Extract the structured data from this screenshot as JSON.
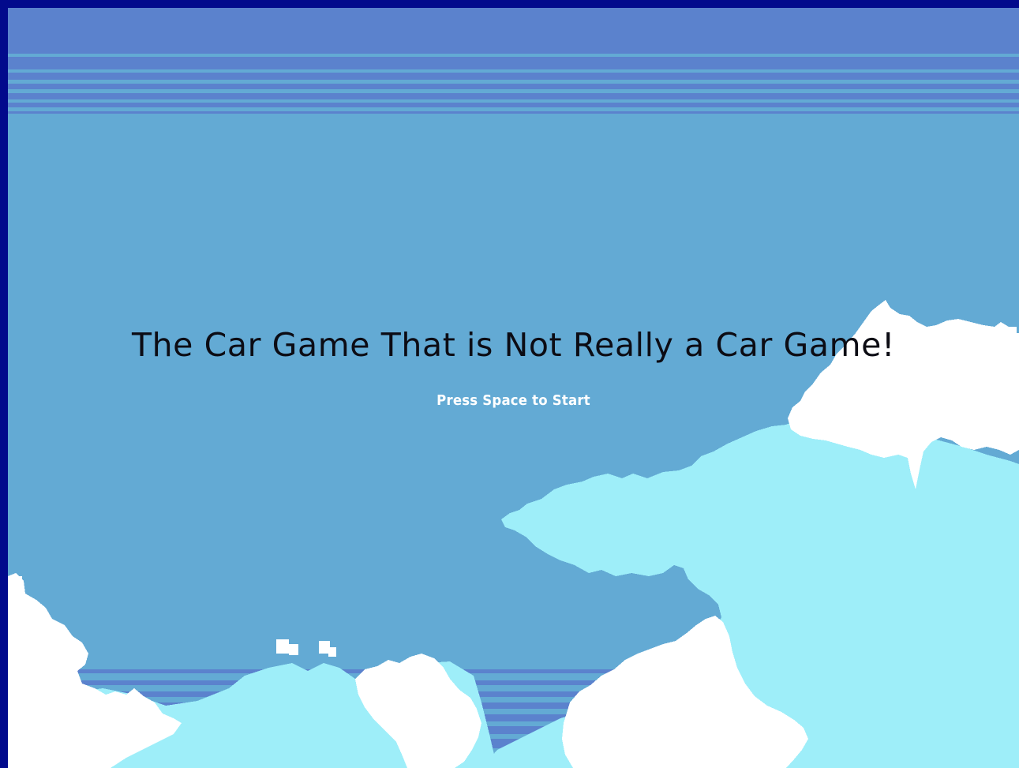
{
  "game": {
    "title": "The Car Game That is Not Really a Car Game!",
    "start_prompt": "Press Space to Start"
  },
  "colors": {
    "border": "#020a8c",
    "sky": "#63aad4",
    "sky_band": "#5b82cd",
    "cloud_light": "#9eeef9",
    "cloud_white": "#ffffff",
    "title_text": "#0c0c14",
    "prompt_text": "#ffffff"
  }
}
